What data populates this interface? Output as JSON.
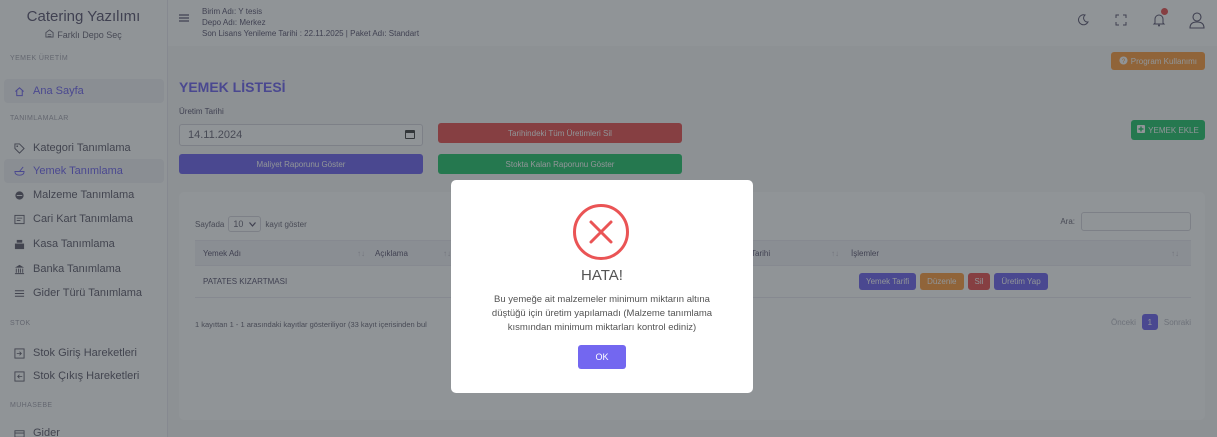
{
  "brand": {
    "title": "Catering Yazılımı",
    "subtitle": "Farklı Depo Seç"
  },
  "sidebar": {
    "sections": {
      "production": "YEMEK ÜRETİM",
      "definitions": "TANIMLAMALAR",
      "stock": "STOK",
      "accounting": "MUHASEBE"
    },
    "items": [
      {
        "label": "Ana Sayfa",
        "icon": "home-icon"
      },
      {
        "label": "Kategori Tanımlama",
        "icon": "tag-icon"
      },
      {
        "label": "Yemek Tanımlama",
        "icon": "food-icon"
      },
      {
        "label": "Malzeme Tanımlama",
        "icon": "ingredient-icon"
      },
      {
        "label": "Cari Kart Tanımlama",
        "icon": "card-icon"
      },
      {
        "label": "Kasa Tanımlama",
        "icon": "cash-register-icon"
      },
      {
        "label": "Banka Tanımlama",
        "icon": "bank-icon"
      },
      {
        "label": "Gider Türü Tanımlama",
        "icon": "list-icon"
      },
      {
        "label": "Stok Giriş Hareketleri",
        "icon": "stock-in-icon"
      },
      {
        "label": "Stok Çıkış Hareketleri",
        "icon": "stock-out-icon"
      },
      {
        "label": "Gider",
        "icon": "expense-icon"
      }
    ]
  },
  "topbar": {
    "unit": "Birim Adı: Y tesis",
    "depot": "Depo Adı: Merkez",
    "license": "Son Lisans Yenileme Tarihi : 22.11.2025 | Paket Adı: Standart",
    "icons": [
      "moon-icon",
      "fullscreen-icon",
      "bell-icon",
      "user-icon"
    ]
  },
  "main": {
    "help_button": "Program Kullanımı",
    "title": "YEMEK LİSTESİ",
    "date_label": "Üretim Tarihi",
    "date_value": "14.11.2024",
    "delete_all_button": "Tarihindeki Tüm Üretimleri Sil",
    "cost_report_button": "Maliyet Raporunu Göster",
    "stock_report_button": "Stokta Kalan Raporunu Göster",
    "add_button": "YEMEK EKLE"
  },
  "table": {
    "length_prefix": "Sayfada",
    "length_value": "10",
    "length_suffix": "kayıt göster",
    "search_label": "Ara:",
    "headers": {
      "name": "Yemek Adı",
      "description": "Açıklama",
      "date": "Tarihi",
      "actions": "İşlemler"
    },
    "rows": [
      {
        "name": "PATATES KIZARTMASI"
      }
    ],
    "actions": {
      "recipe": "Yemek Tarifi",
      "edit": "Düzenle",
      "delete": "Sil",
      "produce": "Üretim Yap"
    },
    "info": "1 kayıttan 1 - 1 arasındaki kayıtlar gösteriliyor (33 kayıt içerisinden bul",
    "pager": {
      "previous": "Önceki",
      "current": "1",
      "next": "Sonraki"
    }
  },
  "modal": {
    "title": "HATA!",
    "message": "Bu yemeğe ait malzemeler minimum miktarın altına düştüğü için üretim yapılamadı (Malzeme tanımlama kısmından minimum miktarları kontrol ediniz)",
    "ok_button": "OK"
  },
  "colors": {
    "primary": "#7367f0",
    "danger": "#ea5455",
    "success": "#28c76f",
    "warning": "#ff9f43",
    "info": "#00cfe8"
  }
}
